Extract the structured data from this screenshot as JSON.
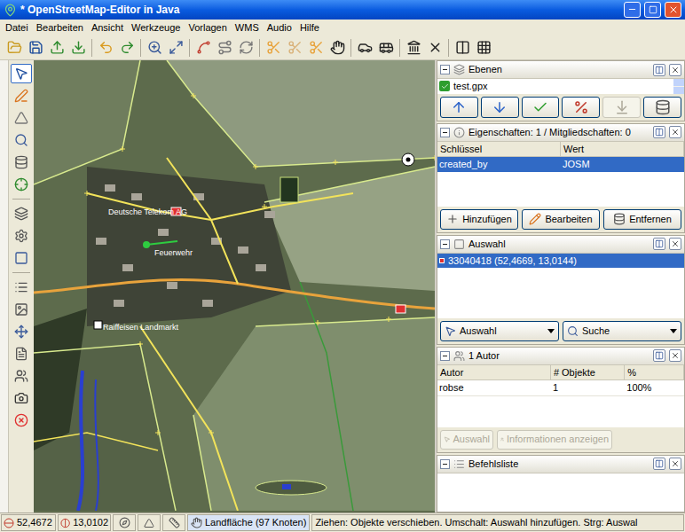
{
  "window": {
    "title": "* OpenStreetMap-Editor in Java"
  },
  "menu": [
    "Datei",
    "Bearbeiten",
    "Ansicht",
    "Werkzeuge",
    "Vorlagen",
    "WMS",
    "Audio",
    "Hilfe"
  ],
  "map": {
    "labels": [
      "Deutsche Telekom AG",
      "Feuerwehr",
      "Raiffeisen Landmarkt"
    ]
  },
  "layers": {
    "title": "Ebenen",
    "items": [
      {
        "name": "test.gpx",
        "selected": false,
        "active": true
      }
    ],
    "buttons": [
      {
        "kind": "up",
        "disabled": false
      },
      {
        "kind": "down",
        "disabled": false
      },
      {
        "kind": "activate",
        "disabled": false
      },
      {
        "kind": "merge",
        "disabled": false
      },
      {
        "kind": "lower",
        "disabled": true
      },
      {
        "kind": "delete",
        "disabled": false
      }
    ]
  },
  "properties": {
    "title": "Eigenschaften: 1 / Mitgliedschaften: 0",
    "columns": [
      "Schlüssel",
      "Wert"
    ],
    "rows": [
      {
        "key": "created_by",
        "value": "JOSM",
        "selected": true
      }
    ],
    "buttons": [
      "Hinzufügen",
      "Bearbeiten",
      "Entfernen"
    ]
  },
  "selection": {
    "title": "Auswahl",
    "items": [
      {
        "label": "33040418 (52,4669, 13,0144)",
        "selected": true
      }
    ],
    "buttons": [
      "Auswahl",
      "Suche"
    ]
  },
  "authors": {
    "title": "1 Autor",
    "columns": [
      "Autor",
      "# Objekte",
      "%"
    ],
    "rows": [
      {
        "author": "robse",
        "objects": "1",
        "percent": "100%",
        "selected": false
      }
    ],
    "buttons": [
      {
        "label": "Auswahl",
        "disabled": true
      },
      {
        "label": "Informationen anzeigen",
        "disabled": true
      }
    ]
  },
  "commands": {
    "title": "Befehlsliste"
  },
  "status_bar": {
    "lat": "52,4672",
    "lon": "13,0102",
    "selection": "Landfläche (97 Knoten)",
    "help": "Ziehen: Objekte verschieben. Umschalt: Auswahl hinzufügen. Strg: Auswal"
  }
}
